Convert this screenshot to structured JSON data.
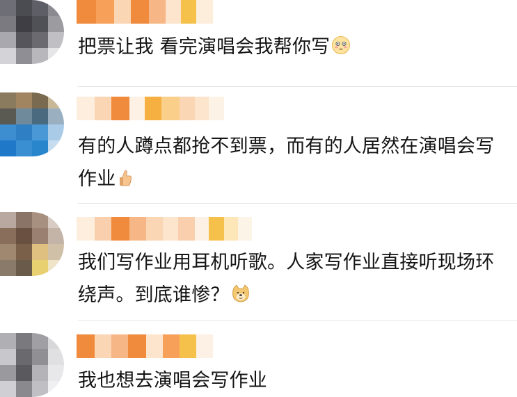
{
  "comments": [
    {
      "text": "把票让我 看完演唱会我帮你写",
      "emoji": "flushed-face-emoji"
    },
    {
      "text": "有的人蹲点都抢不到票，而有的人居然在演唱会写作业",
      "emoji": "thumbs-up-emoji"
    },
    {
      "text": "我们写作业用耳机听歌。人家写作业直接听现场环绕声。到底谁惨？",
      "emoji": "doge-emoji"
    },
    {
      "text": "我也想去演唱会写作业",
      "emoji": ""
    }
  ],
  "colors": {
    "pixel_orange": "#f08a3c",
    "pixel_light": "#fbd6b4",
    "pixel_yellow": "#f6c14a",
    "divider": "#e6e6e6",
    "text": "#141414"
  }
}
